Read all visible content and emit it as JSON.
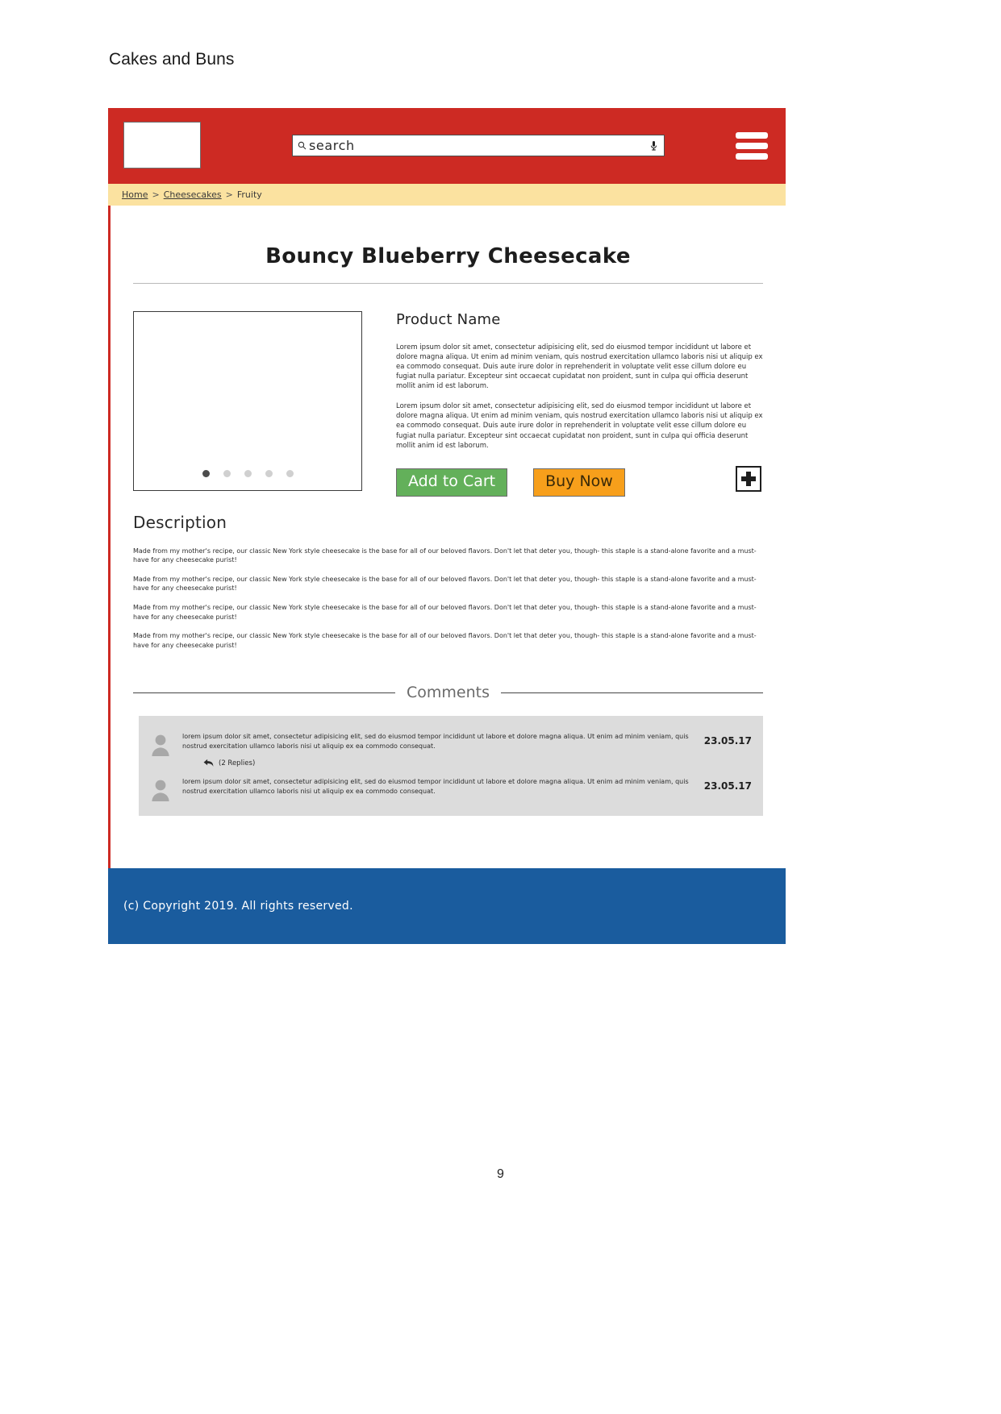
{
  "document": {
    "header_title": "Cakes and Buns",
    "page_number": "9"
  },
  "colors": {
    "header_red": "#cd2a23",
    "breadcrumb_yellow": "#fbe2a0",
    "footer_blue": "#1a5c9e",
    "cart_green": "#63b05a",
    "buy_orange": "#f79f1b",
    "comments_grey": "#dcdcdc"
  },
  "topbar": {
    "logo_alt": "logo-placeholder",
    "search": {
      "placeholder": "search",
      "icon": "search-icon",
      "mic_icon": "microphone-icon"
    },
    "menu_icon": "hamburger-menu-icon"
  },
  "breadcrumb": {
    "items": [
      {
        "label": "Home",
        "link": true
      },
      {
        "label": "Cheesecakes",
        "link": true
      },
      {
        "label": "Fruity",
        "link": false
      }
    ],
    "separator": ">"
  },
  "product": {
    "title": "Bouncy Blueberry Cheesecake",
    "name_heading": "Product Name",
    "paragraphs": [
      "Lorem ipsum dolor sit amet, consectetur adipisicing elit, sed do eiusmod tempor incididunt ut labore et dolore magna aliqua. Ut enim ad minim veniam, quis nostrud exercitation ullamco laboris nisi ut aliquip ex ea commodo consequat. Duis aute irure dolor in reprehenderit in voluptate velit esse cillum dolore eu fugiat nulla pariatur. Excepteur sint occaecat cupidatat non proident, sunt in culpa qui officia deserunt mollit anim id est laborum.",
      "Lorem ipsum dolor sit amet, consectetur adipisicing elit, sed do eiusmod tempor incididunt ut labore et dolore magna aliqua. Ut enim ad minim veniam, quis nostrud exercitation ullamco laboris nisi ut aliquip ex ea commodo consequat. Duis aute irure dolor in reprehenderit in voluptate velit esse cillum dolore eu fugiat nulla pariatur. Excepteur sint occaecat cupidatat non proident, sunt in culpa qui officia deserunt mollit anim id est laborum."
    ],
    "gallery": {
      "dot_count": 5,
      "active_dot": 0
    },
    "add_to_cart_label": "Add to Cart",
    "buy_now_label": "Buy Now",
    "add_icon": "plus-icon"
  },
  "description": {
    "heading": "Description",
    "paragraphs": [
      "Made from my mother's recipe, our classic New York style cheesecake is the base for all of our beloved flavors. Don't let that deter you, though- this staple is a stand-alone favorite and a must-have for any cheesecake purist!",
      "Made from my mother's recipe, our classic New York style cheesecake is the base for all of our beloved flavors. Don't let that deter you, though- this staple is a stand-alone favorite and a must-have for any cheesecake purist!",
      "Made from my mother's recipe, our classic New York style cheesecake is the base for all of our beloved flavors. Don't let that deter you, though- this staple is a stand-alone favorite and a must-have for any cheesecake purist!",
      "Made from my mother's recipe, our classic New York style cheesecake is the base for all of our beloved flavors. Don't let that deter you, though- this staple is a stand-alone favorite and a must-have for any cheesecake purist!"
    ]
  },
  "comments": {
    "heading": "Comments",
    "items": [
      {
        "avatar_icon": "user-avatar-icon",
        "text": "lorem ipsum dolor sit amet, consectetur adipisicing elit, sed do eiusmod tempor incididunt ut labore et dolore magna aliqua. Ut enim ad minim veniam, quis nostrud exercitation ullamco laboris nisi ut aliquip ex ea commodo consequat.",
        "replies_label": "(2 Replies)",
        "reply_icon": "reply-arrow-icon",
        "date": "23.05.17",
        "has_replies": true
      },
      {
        "avatar_icon": "user-avatar-icon",
        "text": "lorem ipsum dolor sit amet, consectetur adipisicing elit, sed do eiusmod tempor incididunt ut labore et dolore magna aliqua. Ut enim ad minim veniam, quis nostrud exercitation ullamco laboris nisi ut aliquip ex ea commodo consequat.",
        "replies_label": "",
        "reply_icon": "",
        "date": "23.05.17",
        "has_replies": false
      }
    ]
  },
  "footer": {
    "copyright": "(c) Copyright 2019. All rights reserved."
  }
}
